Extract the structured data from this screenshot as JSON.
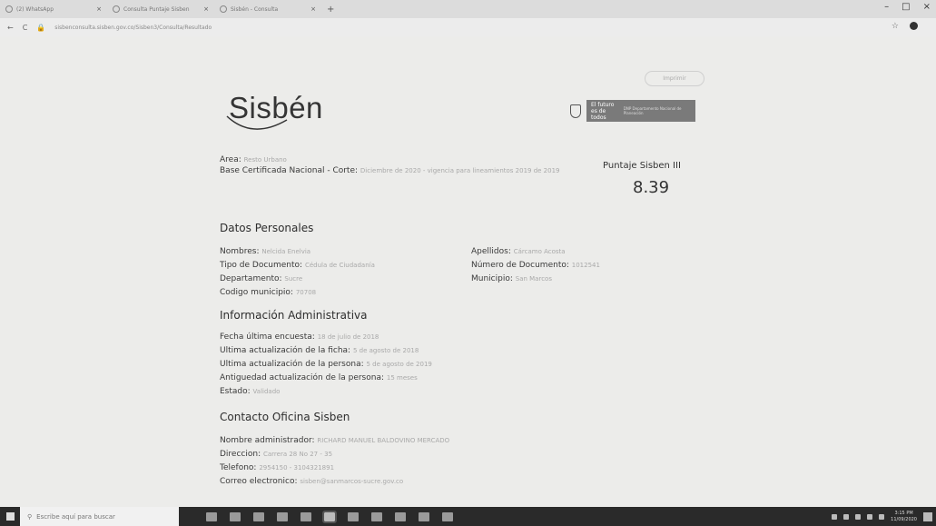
{
  "browser": {
    "tabs": [
      {
        "label": "(2) WhatsApp"
      },
      {
        "label": "Consulta Puntaje Sisben"
      },
      {
        "label": "Sisbén - Consulta"
      }
    ],
    "new_tab": "+",
    "window_controls": {
      "minimize": "–",
      "maximize": "□",
      "close": "×"
    },
    "nav": {
      "back": "←",
      "reload": "C"
    },
    "url": "sisbenconsulta.sisben.gov.co/Sisben3/Consulta/Resultado"
  },
  "page": {
    "print_button": "Imprimir",
    "logo_text": "Sisbén",
    "gov_logo": {
      "line1": "El futuro",
      "line2": "es de todos",
      "right": "DNP Departamento Nacional de Planeación"
    },
    "area_label": "Area:",
    "area_value": "Resto Urbano",
    "base_label": "Base Certificada Nacional - Corte:",
    "base_value": "Diciembre de 2020 - vigencia para lineamientos 2019 de 2019",
    "score_title": "Puntaje Sisben III",
    "score_value": "8.39",
    "sections": {
      "personal": "Datos Personales",
      "admin": "Información Administrativa",
      "contact": "Contacto Oficina Sisben"
    },
    "personal_left": [
      {
        "label": "Nombres:",
        "value": "Nelcida Enelvia"
      },
      {
        "label": "Tipo de Documento:",
        "value": "Cédula de Ciudadanía"
      },
      {
        "label": "Departamento:",
        "value": "Sucre"
      },
      {
        "label": "Codigo municipio:",
        "value": "70708"
      }
    ],
    "personal_right": [
      {
        "label": "Apellidos:",
        "value": "Cárcamo Acosta"
      },
      {
        "label": "Número de Documento:",
        "value": "1012541"
      },
      {
        "label": "Municipio:",
        "value": "San Marcos"
      }
    ],
    "admin_fields": [
      {
        "label": "Fecha última encuesta:",
        "value": "18 de julio de 2018"
      },
      {
        "label": "Ultima actualización de la ficha:",
        "value": "5 de agosto de 2018"
      },
      {
        "label": "Ultima actualización de la persona:",
        "value": "5 de agosto de 2019"
      },
      {
        "label": "Antiguedad actualización de la persona:",
        "value": "15 meses"
      },
      {
        "label": "Estado:",
        "value": "Validado"
      }
    ],
    "contact_fields": [
      {
        "label": "Nombre administrador:",
        "value": "RICHARD MANUEL BALDOVINO MERCADO"
      },
      {
        "label": "Direccion:",
        "value": "Carrera 28 No 27 - 35"
      },
      {
        "label": "Telefono:",
        "value": "2954150 - 3104321891"
      },
      {
        "label": "Correo electronico:",
        "value": "sisben@sanmarcos-sucre.gov.co"
      }
    ]
  },
  "taskbar": {
    "search_placeholder": "Escribe aquí para buscar",
    "time": "3:15 PM",
    "date": "11/09/2020"
  },
  "colors": {
    "page_bg": "#ececea",
    "taskbar_bg": "#2a2a2a",
    "gov_box": "#7a7a7a"
  }
}
